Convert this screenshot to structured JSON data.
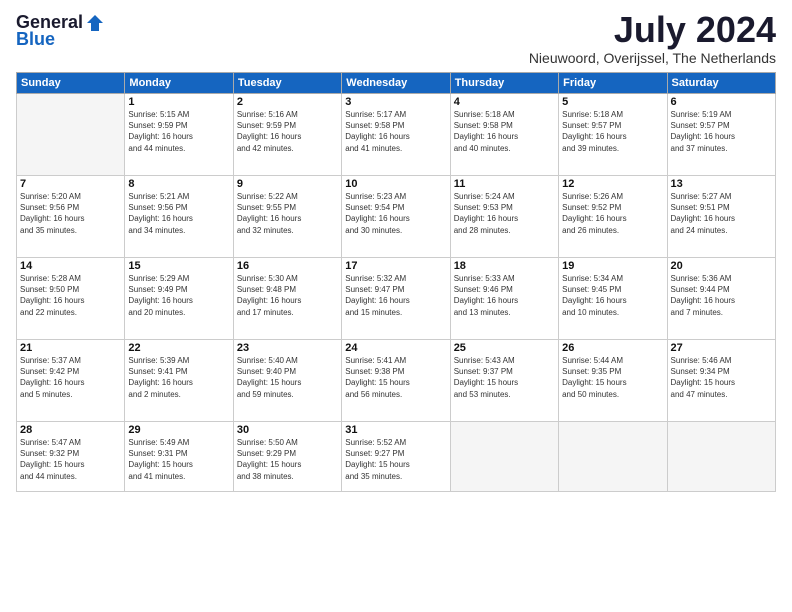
{
  "logo": {
    "general": "General",
    "blue": "Blue"
  },
  "title": {
    "month_year": "July 2024",
    "location": "Nieuwoord, Overijssel, The Netherlands"
  },
  "headers": [
    "Sunday",
    "Monday",
    "Tuesday",
    "Wednesday",
    "Thursday",
    "Friday",
    "Saturday"
  ],
  "weeks": [
    [
      {
        "day": "",
        "info": ""
      },
      {
        "day": "1",
        "info": "Sunrise: 5:15 AM\nSunset: 9:59 PM\nDaylight: 16 hours\nand 44 minutes."
      },
      {
        "day": "2",
        "info": "Sunrise: 5:16 AM\nSunset: 9:59 PM\nDaylight: 16 hours\nand 42 minutes."
      },
      {
        "day": "3",
        "info": "Sunrise: 5:17 AM\nSunset: 9:58 PM\nDaylight: 16 hours\nand 41 minutes."
      },
      {
        "day": "4",
        "info": "Sunrise: 5:18 AM\nSunset: 9:58 PM\nDaylight: 16 hours\nand 40 minutes."
      },
      {
        "day": "5",
        "info": "Sunrise: 5:18 AM\nSunset: 9:57 PM\nDaylight: 16 hours\nand 39 minutes."
      },
      {
        "day": "6",
        "info": "Sunrise: 5:19 AM\nSunset: 9:57 PM\nDaylight: 16 hours\nand 37 minutes."
      }
    ],
    [
      {
        "day": "7",
        "info": "Sunrise: 5:20 AM\nSunset: 9:56 PM\nDaylight: 16 hours\nand 35 minutes."
      },
      {
        "day": "8",
        "info": "Sunrise: 5:21 AM\nSunset: 9:56 PM\nDaylight: 16 hours\nand 34 minutes."
      },
      {
        "day": "9",
        "info": "Sunrise: 5:22 AM\nSunset: 9:55 PM\nDaylight: 16 hours\nand 32 minutes."
      },
      {
        "day": "10",
        "info": "Sunrise: 5:23 AM\nSunset: 9:54 PM\nDaylight: 16 hours\nand 30 minutes."
      },
      {
        "day": "11",
        "info": "Sunrise: 5:24 AM\nSunset: 9:53 PM\nDaylight: 16 hours\nand 28 minutes."
      },
      {
        "day": "12",
        "info": "Sunrise: 5:26 AM\nSunset: 9:52 PM\nDaylight: 16 hours\nand 26 minutes."
      },
      {
        "day": "13",
        "info": "Sunrise: 5:27 AM\nSunset: 9:51 PM\nDaylight: 16 hours\nand 24 minutes."
      }
    ],
    [
      {
        "day": "14",
        "info": "Sunrise: 5:28 AM\nSunset: 9:50 PM\nDaylight: 16 hours\nand 22 minutes."
      },
      {
        "day": "15",
        "info": "Sunrise: 5:29 AM\nSunset: 9:49 PM\nDaylight: 16 hours\nand 20 minutes."
      },
      {
        "day": "16",
        "info": "Sunrise: 5:30 AM\nSunset: 9:48 PM\nDaylight: 16 hours\nand 17 minutes."
      },
      {
        "day": "17",
        "info": "Sunrise: 5:32 AM\nSunset: 9:47 PM\nDaylight: 16 hours\nand 15 minutes."
      },
      {
        "day": "18",
        "info": "Sunrise: 5:33 AM\nSunset: 9:46 PM\nDaylight: 16 hours\nand 13 minutes."
      },
      {
        "day": "19",
        "info": "Sunrise: 5:34 AM\nSunset: 9:45 PM\nDaylight: 16 hours\nand 10 minutes."
      },
      {
        "day": "20",
        "info": "Sunrise: 5:36 AM\nSunset: 9:44 PM\nDaylight: 16 hours\nand 7 minutes."
      }
    ],
    [
      {
        "day": "21",
        "info": "Sunrise: 5:37 AM\nSunset: 9:42 PM\nDaylight: 16 hours\nand 5 minutes."
      },
      {
        "day": "22",
        "info": "Sunrise: 5:39 AM\nSunset: 9:41 PM\nDaylight: 16 hours\nand 2 minutes."
      },
      {
        "day": "23",
        "info": "Sunrise: 5:40 AM\nSunset: 9:40 PM\nDaylight: 15 hours\nand 59 minutes."
      },
      {
        "day": "24",
        "info": "Sunrise: 5:41 AM\nSunset: 9:38 PM\nDaylight: 15 hours\nand 56 minutes."
      },
      {
        "day": "25",
        "info": "Sunrise: 5:43 AM\nSunset: 9:37 PM\nDaylight: 15 hours\nand 53 minutes."
      },
      {
        "day": "26",
        "info": "Sunrise: 5:44 AM\nSunset: 9:35 PM\nDaylight: 15 hours\nand 50 minutes."
      },
      {
        "day": "27",
        "info": "Sunrise: 5:46 AM\nSunset: 9:34 PM\nDaylight: 15 hours\nand 47 minutes."
      }
    ],
    [
      {
        "day": "28",
        "info": "Sunrise: 5:47 AM\nSunset: 9:32 PM\nDaylight: 15 hours\nand 44 minutes."
      },
      {
        "day": "29",
        "info": "Sunrise: 5:49 AM\nSunset: 9:31 PM\nDaylight: 15 hours\nand 41 minutes."
      },
      {
        "day": "30",
        "info": "Sunrise: 5:50 AM\nSunset: 9:29 PM\nDaylight: 15 hours\nand 38 minutes."
      },
      {
        "day": "31",
        "info": "Sunrise: 5:52 AM\nSunset: 9:27 PM\nDaylight: 15 hours\nand 35 minutes."
      },
      {
        "day": "",
        "info": ""
      },
      {
        "day": "",
        "info": ""
      },
      {
        "day": "",
        "info": ""
      }
    ]
  ]
}
